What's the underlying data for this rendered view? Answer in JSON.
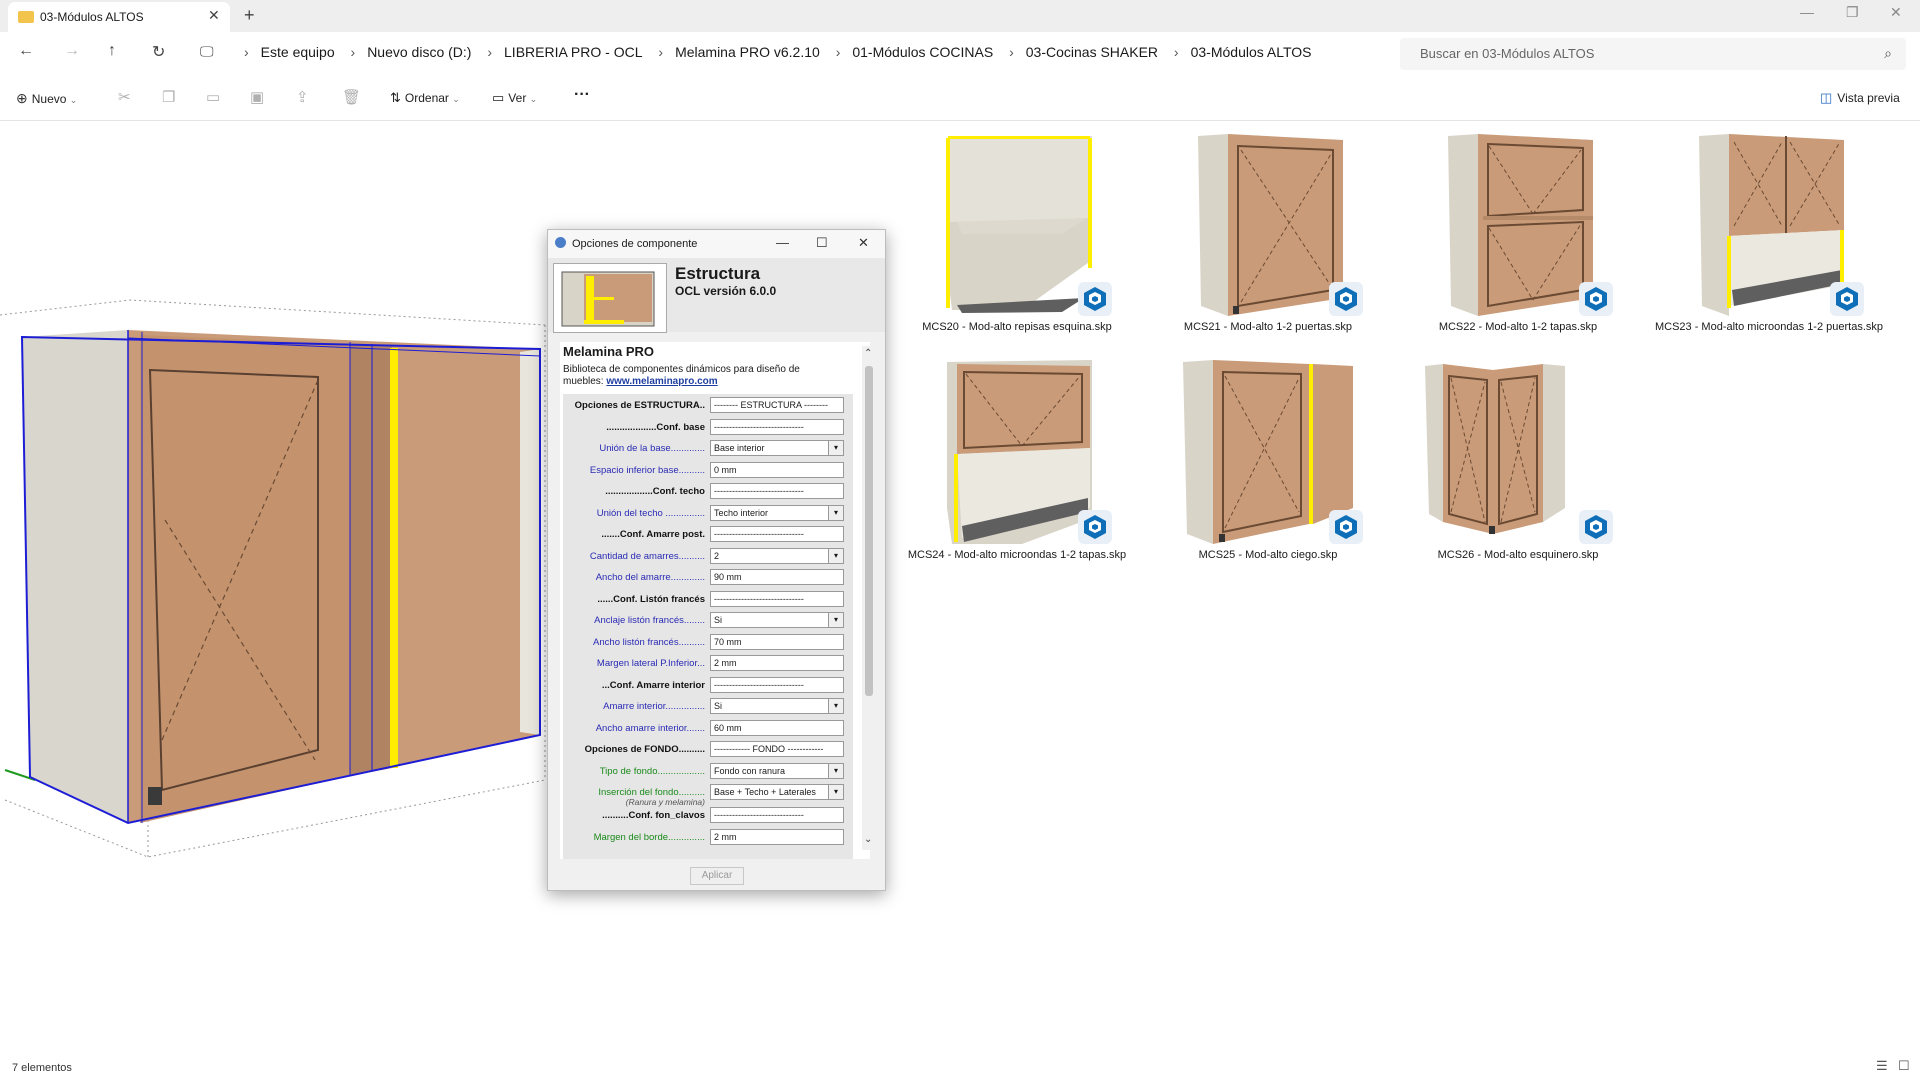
{
  "window": {
    "tab_title": "03-Módulos ALTOS",
    "close_tab": "✕",
    "new_tab": "+",
    "minimize": "—",
    "maximize": "❐",
    "close": "✕"
  },
  "nav": {
    "back": "←",
    "forward": "→",
    "up": "↑",
    "refresh": "↻",
    "pc": "🖵"
  },
  "breadcrumb": [
    "Este equipo",
    "Nuevo disco (D:)",
    "LIBRERIA PRO - OCL",
    "Melamina PRO v6.2.10",
    "01-Módulos COCINAS",
    "03-Cocinas SHAKER",
    "03-Módulos ALTOS"
  ],
  "search": {
    "placeholder": "Buscar en 03-Módulos ALTOS",
    "icon": "⌕"
  },
  "toolbar": {
    "new_label": "Nuevo",
    "sort_label": "Ordenar",
    "view_label": "Ver",
    "more": "···",
    "preview_label": "Vista previa"
  },
  "dialog": {
    "title": "Opciones de componente",
    "minimize": "—",
    "maximize": "☐",
    "close": "✕",
    "component_name": "Estructura",
    "version": "OCL versión 6.0.0",
    "library_title": "Melamina PRO",
    "library_desc": "Biblioteca de componentes dinámicos para diseño de muebles:",
    "library_link": "www.melaminapro.com",
    "apply_label": "Aplicar",
    "scroll_up": "⌃",
    "scroll_down": "⌄",
    "rows": [
      {
        "label": "Opciones de ESTRUCTURA..",
        "value": "-------- ESTRUCTURA --------",
        "style": "b"
      },
      {
        "label": "...................Conf. base",
        "value": "------------------------------",
        "style": "b"
      },
      {
        "label": "Unión de la base.............",
        "value": "Base interior",
        "style": "n",
        "select": true
      },
      {
        "label": "Espacio inferior base..........",
        "value": "0 mm",
        "style": "n"
      },
      {
        "label": "..................Conf. techo",
        "value": "------------------------------",
        "style": "b"
      },
      {
        "label": "Unión del techo ...............",
        "value": "Techo interior",
        "style": "n",
        "select": true
      },
      {
        "label": ".......Conf. Amarre post.",
        "value": "------------------------------",
        "style": "b"
      },
      {
        "label": "Cantidad de amarres..........",
        "value": "2",
        "style": "n",
        "select": true
      },
      {
        "label": "Ancho del amarre.............",
        "value": "90 mm",
        "style": "n"
      },
      {
        "label": "......Conf. Listón francés",
        "value": "------------------------------",
        "style": "b"
      },
      {
        "label": "Anclaje listón francés........",
        "value": "Si",
        "style": "n",
        "select": true
      },
      {
        "label": "Ancho listón francés..........",
        "value": "70 mm",
        "style": "n"
      },
      {
        "label": "Margen lateral P.Inferior...",
        "value": "2 mm",
        "style": "n"
      },
      {
        "label": "...Conf. Amarre interior",
        "value": "------------------------------",
        "style": "b"
      },
      {
        "label": "Amarre interior...............",
        "value": "Si",
        "style": "n",
        "select": true
      },
      {
        "label": "Ancho amarre interior.......",
        "value": "60 mm",
        "style": "n"
      },
      {
        "label": "Opciones de FONDO..........",
        "value": "------------ FONDO ------------",
        "style": "b"
      },
      {
        "label": "Tipo de fondo..................",
        "value": "Fondo con ranura",
        "style": "g",
        "select": true
      },
      {
        "label": "Inserción del fondo..........",
        "sub": "(Ranura y melamina)",
        "value": "Base + Techo + Laterales",
        "style": "g",
        "select": true
      },
      {
        "label": "..........Conf. fon_clavos",
        "value": "------------------------------",
        "style": "b"
      },
      {
        "label": "Margen del borde..............",
        "value": "2 mm",
        "style": "g"
      }
    ]
  },
  "files": [
    {
      "name": "MCS20 - Mod-alto repisas esquina.skp",
      "icon": "sketchup-icon"
    },
    {
      "name": "MCS21 - Mod-alto 1-2 puertas.skp",
      "icon": "sketchup-icon"
    },
    {
      "name": "MCS22 - Mod-alto 1-2 tapas.skp",
      "icon": "sketchup-icon"
    },
    {
      "name": "MCS23 - Mod-alto microondas 1-2 puertas.skp",
      "icon": "sketchup-icon"
    },
    {
      "name": "MCS24 - Mod-alto microondas 1-2 tapas.skp",
      "icon": "sketchup-icon"
    },
    {
      "name": "MCS25 - Mod-alto ciego.skp",
      "icon": "sketchup-icon"
    },
    {
      "name": "MCS26 - Mod-alto esquinero.skp",
      "icon": "sketchup-icon"
    }
  ],
  "status": {
    "count": "7 elementos"
  },
  "colors": {
    "wood": "#c99b78",
    "carcass": "#d9d4c8",
    "selection": "#1d1dd6",
    "highlight": "#ffee00"
  }
}
